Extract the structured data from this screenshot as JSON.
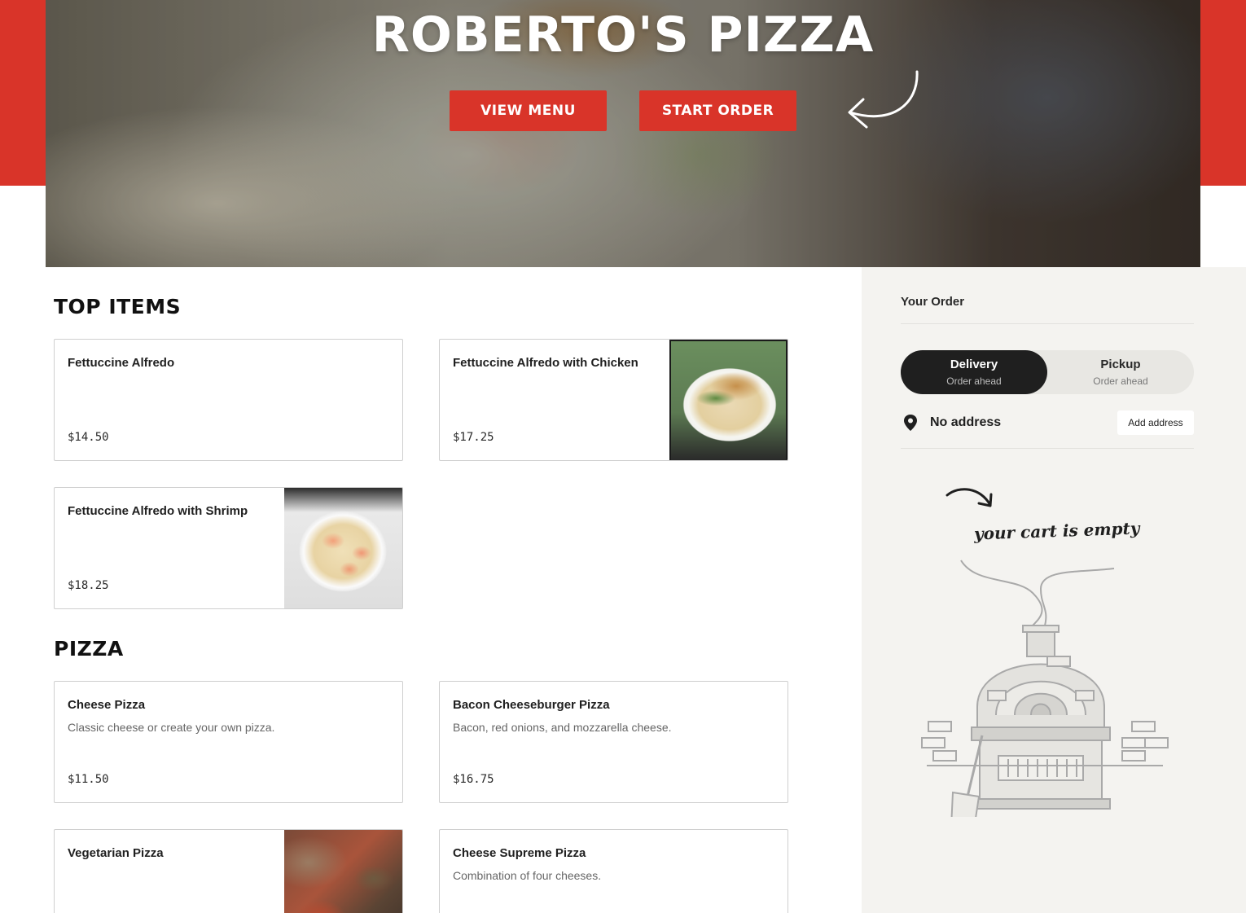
{
  "hero": {
    "title": "ROBERTO'S PIZZA",
    "view_menu_label": "VIEW MENU",
    "start_order_label": "START ORDER"
  },
  "colors": {
    "brand_red": "#d93429",
    "dark": "#1f1f1f",
    "sidebar_bg": "#f4f3f0"
  },
  "sections": {
    "top_items": {
      "title": "TOP ITEMS",
      "items": [
        {
          "name": "Fettuccine Alfredo",
          "description": "",
          "price": "$14.50",
          "image": "none"
        },
        {
          "name": "Fettuccine Alfredo with Chicken",
          "description": "",
          "price": "$17.25",
          "image": "fettuccine-chicken-photo"
        },
        {
          "name": "Fettuccine Alfredo with Shrimp",
          "description": "",
          "price": "$18.25",
          "image": "fettuccine-shrimp-photo"
        }
      ]
    },
    "pizza": {
      "title": "PIZZA",
      "items": [
        {
          "name": "Cheese Pizza",
          "description": "Classic cheese or create your own pizza.",
          "price": "$11.50",
          "image": "none"
        },
        {
          "name": "Bacon Cheeseburger Pizza",
          "description": "Bacon, red onions, and mozzarella cheese.",
          "price": "$16.75",
          "image": "none"
        },
        {
          "name": "Vegetarian Pizza",
          "description": "",
          "price": "",
          "image": "vegetarian-pizza-photo"
        },
        {
          "name": "Cheese Supreme Pizza",
          "description": "Combination of four cheeses.",
          "price": "",
          "image": "none"
        }
      ]
    }
  },
  "order": {
    "title": "Your Order",
    "delivery": {
      "label": "Delivery",
      "sub": "Order ahead",
      "selected": true
    },
    "pickup": {
      "label": "Pickup",
      "sub": "Order ahead",
      "selected": false
    },
    "address": {
      "value": "No address",
      "button_label": "Add address",
      "icon": "location-pin-icon"
    },
    "empty_cart_text": "your cart is empty",
    "empty_cart_illustration": "pizza-oven-illustration"
  }
}
